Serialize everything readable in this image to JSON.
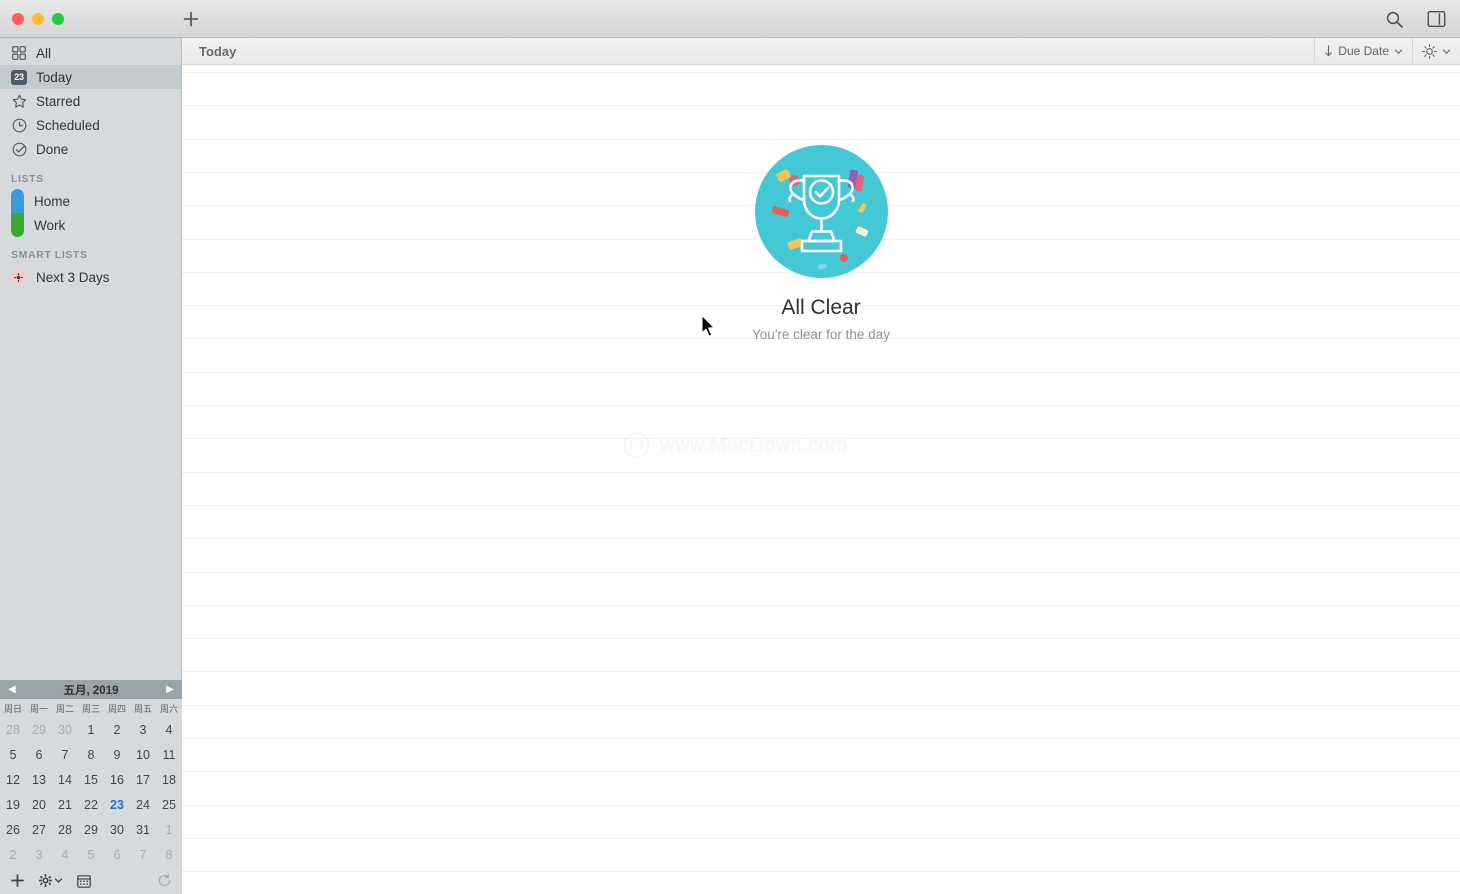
{
  "window": {
    "traffic_lights": [
      {
        "name": "close",
        "color": "#ff5f57"
      },
      {
        "name": "minimize",
        "color": "#febc2e"
      },
      {
        "name": "zoom",
        "color": "#28c840"
      }
    ],
    "add_button_icon": "plus-icon",
    "search_icon": "search-icon",
    "sidebar_toggle_icon": "sidebar-toggle-icon"
  },
  "sidebar": {
    "nav": [
      {
        "label": "All",
        "icon": "grid-icon",
        "selected": false
      },
      {
        "label": "Today",
        "icon": "calendar-badge-icon",
        "badge": "23",
        "selected": true
      },
      {
        "label": "Starred",
        "icon": "star-icon",
        "selected": false
      },
      {
        "label": "Scheduled",
        "icon": "clock-icon",
        "selected": false
      },
      {
        "label": "Done",
        "icon": "check-circle-icon",
        "selected": false
      }
    ],
    "lists_header": "LISTS",
    "lists": [
      {
        "label": "Home",
        "color": "#3a9bdc"
      },
      {
        "label": "Work",
        "color": "#3aa832"
      }
    ],
    "smart_lists_header": "SMART LISTS",
    "smart_lists": [
      {
        "label": "Next 3 Days",
        "icon": "gear-icon",
        "color": "#f9c9c4"
      }
    ],
    "footer": {
      "add_icon": "plus-icon",
      "settings_icon": "gear-icon",
      "settings_chevron_icon": "chevron-down-icon",
      "calendar_icon": "calendar-icon",
      "sync_icon": "refresh-icon"
    }
  },
  "calendar": {
    "prev_icon": "chevron-left-icon",
    "next_icon": "chevron-right-icon",
    "title": "五月, 2019",
    "weekdays": [
      "周日",
      "周一",
      "周二",
      "周三",
      "周四",
      "周五",
      "周六"
    ],
    "weeks": [
      [
        {
          "d": "28",
          "m": true
        },
        {
          "d": "29",
          "m": true
        },
        {
          "d": "30",
          "m": true
        },
        {
          "d": "1"
        },
        {
          "d": "2"
        },
        {
          "d": "3"
        },
        {
          "d": "4"
        }
      ],
      [
        {
          "d": "5"
        },
        {
          "d": "6"
        },
        {
          "d": "7"
        },
        {
          "d": "8"
        },
        {
          "d": "9"
        },
        {
          "d": "10"
        },
        {
          "d": "11"
        }
      ],
      [
        {
          "d": "12"
        },
        {
          "d": "13"
        },
        {
          "d": "14"
        },
        {
          "d": "15"
        },
        {
          "d": "16"
        },
        {
          "d": "17"
        },
        {
          "d": "18"
        }
      ],
      [
        {
          "d": "19"
        },
        {
          "d": "20"
        },
        {
          "d": "21"
        },
        {
          "d": "22"
        },
        {
          "d": "23",
          "t": true
        },
        {
          "d": "24"
        },
        {
          "d": "25"
        }
      ],
      [
        {
          "d": "26"
        },
        {
          "d": "27"
        },
        {
          "d": "28"
        },
        {
          "d": "29"
        },
        {
          "d": "30"
        },
        {
          "d": "31"
        },
        {
          "d": "1",
          "m": true
        }
      ],
      [
        {
          "d": "2",
          "m": true
        },
        {
          "d": "3",
          "m": true
        },
        {
          "d": "4",
          "m": true
        },
        {
          "d": "5",
          "m": true
        },
        {
          "d": "6",
          "m": true
        },
        {
          "d": "7",
          "m": true
        },
        {
          "d": "8",
          "m": true
        }
      ]
    ]
  },
  "main": {
    "title": "Today",
    "sort": {
      "direction_icon": "sort-descending-icon",
      "label": "Due Date",
      "chevron_icon": "chevron-down-icon"
    },
    "display": {
      "icon": "brightness-icon",
      "chevron_icon": "chevron-down-icon"
    },
    "empty_state": {
      "illustration": "trophy-icon",
      "circle_color": "#45c8d6",
      "title": "All Clear",
      "subtitle": "You're clear for the day"
    }
  },
  "watermark": {
    "logo": "macdown-logo-icon",
    "text": "www.MacDown.com"
  }
}
